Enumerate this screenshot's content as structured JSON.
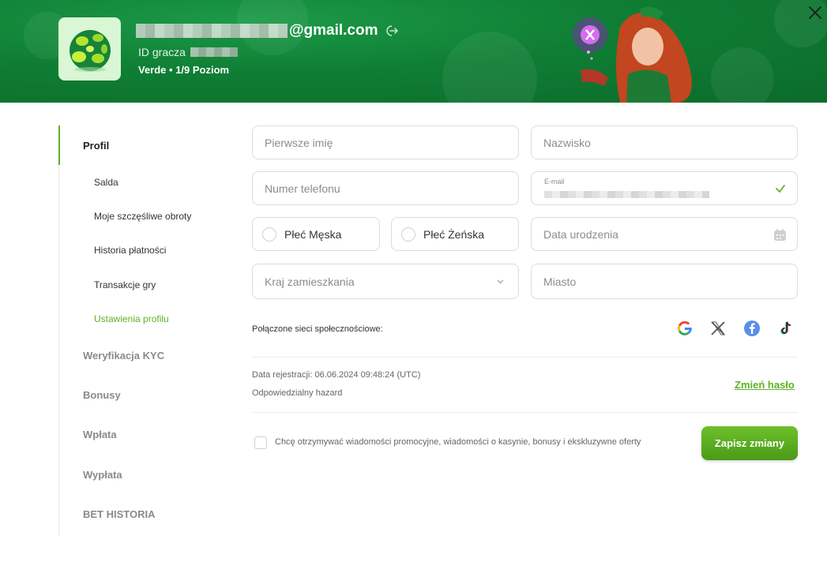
{
  "header": {
    "email_domain": "@gmail.com",
    "player_id_label": "ID gracza",
    "level": "Verde • 1/9 Poziom"
  },
  "sidebar": {
    "items": [
      {
        "label": "Profil",
        "active": true
      },
      {
        "label": "Salda"
      },
      {
        "label": "Moje szczęśliwe obroty"
      },
      {
        "label": "Historia płatności"
      },
      {
        "label": "Transakcje gry"
      },
      {
        "label": "Ustawienia profilu",
        "active": true
      },
      {
        "label": "Weryfikacja KYC"
      },
      {
        "label": "Bonusy"
      },
      {
        "label": "Wpłata"
      },
      {
        "label": "Wypłata"
      },
      {
        "label": "BET HISTORIA"
      }
    ]
  },
  "form": {
    "first_name_placeholder": "Pierwsze imię",
    "last_name_placeholder": "Nazwisko",
    "phone_placeholder": "Numer telefonu",
    "email_label": "E-mail",
    "gender_male": "Płeć Męska",
    "gender_female": "Płeć Żeńska",
    "birthdate_placeholder": "Data urodzenia",
    "country_placeholder": "Kraj zamieszkania",
    "city_placeholder": "Miasto"
  },
  "social": {
    "label": "Połączone sieci społecznościowe:",
    "icons": [
      "google-icon",
      "x-icon",
      "facebook-icon",
      "tiktok-icon"
    ]
  },
  "account": {
    "registration": "Data rejestracji: 06.06.2024 09:48:24 (UTC)",
    "responsible_gambling": "Odpowiedzialny hazard",
    "change_password": "Zmień hasło"
  },
  "promo": {
    "checkbox_label": "Chcę otrzymywać wiadomości promocyjne, wiadomości o kasynie, bonusy i ekskluzywne oferty",
    "save_button": "Zapisz zmiany"
  },
  "colors": {
    "accent": "#5fb126",
    "header_green": "#0f7e34"
  }
}
